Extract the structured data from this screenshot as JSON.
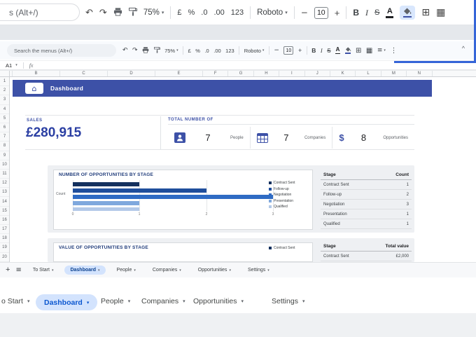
{
  "toolbar": {
    "search_full": "Search the menus (Alt+/)",
    "search_cropped": "s (Alt+/)",
    "zoom": "75%",
    "currency": "£",
    "percent": "%",
    "decimal_decrease": ".0",
    "decimal_increase": ".00",
    "format_number": "123",
    "font_name": "Roboto",
    "minus": "−",
    "font_size": "10",
    "plus": "+",
    "bold": "B",
    "italic": "I",
    "strikethrough": "S",
    "text_color": "A"
  },
  "icons": {
    "undo": "↶",
    "redo": "↷",
    "caret_down": "▾",
    "borders": "⊞",
    "merge": "▦",
    "align": "≡",
    "more_vertical": "⋮",
    "collapse": "^",
    "plus": "+",
    "hamburger": "≡",
    "home": "⌂",
    "dollar": "$"
  },
  "formula_bar": {
    "cell_reference": "A1",
    "fx_label": "fx"
  },
  "grid": {
    "column_letters": [
      "B",
      "C",
      "D",
      "E",
      "F",
      "G",
      "H",
      "I",
      "J",
      "K",
      "L",
      "M",
      "N"
    ],
    "row_numbers": [
      "1",
      "2",
      "3",
      "4",
      "5",
      "6",
      "7",
      "8",
      "9",
      "10",
      "11",
      "12",
      "13",
      "14",
      "15",
      "16",
      "17",
      "18",
      "19",
      "20"
    ]
  },
  "dashboard": {
    "header_title": "Dashboard",
    "sales_label": "SALES",
    "sales_value": "£280,915",
    "totals_label": "TOTAL NUMBER OF",
    "metrics": [
      {
        "value": "7",
        "label": "People"
      },
      {
        "value": "7",
        "label": "Companies"
      },
      {
        "value": "8",
        "label": "Opportunities"
      }
    ],
    "opportunities_chart": {
      "type": "bar",
      "title": "NUMBER OF OPPORTUNITIES BY STAGE",
      "ylabel": "Count",
      "categories": [
        "Contract Sent",
        "Follow-up",
        "Negotiation",
        "Presentation",
        "Qualified"
      ],
      "values": [
        1,
        2,
        3,
        1,
        1
      ],
      "colors": [
        "#14305e",
        "#1f4e9c",
        "#2f6bc4",
        "#7fa8dd",
        "#b3c9e8"
      ],
      "x_ticks": [
        "0",
        "1",
        "2",
        "3"
      ],
      "xlim": [
        0,
        3
      ],
      "legend_position": "right"
    },
    "stage_count_table": {
      "headers": [
        "Stage",
        "Count"
      ],
      "rows": [
        [
          "Contract Sent",
          "1"
        ],
        [
          "Follow-up",
          "2"
        ],
        [
          "Negotiation",
          "3"
        ],
        [
          "Presentation",
          "1"
        ],
        [
          "Qualified",
          "1"
        ]
      ]
    },
    "value_chart_title": "VALUE OF OPPORTUNITIES BY STAGE",
    "value_chart_legend": [
      "Contract Sent"
    ],
    "value_table": {
      "headers": [
        "Stage",
        "Total value"
      ],
      "rows": [
        [
          "Contract Sent",
          "£2,000"
        ]
      ]
    }
  },
  "sheet_tabs": {
    "items": [
      "To Start",
      "Dashboard",
      "People",
      "Companies",
      "Opportunities",
      "Settings"
    ],
    "active": "Dashboard"
  },
  "zoomed_tabs": {
    "items": [
      "o Start",
      "Dashboard",
      "People",
      "Companies",
      "Opportunities",
      "Settings"
    ],
    "active": "Dashboard"
  },
  "colors": {
    "dashboard_header_blue": "#3d51a7",
    "sales_value_blue": "#2b3fa3",
    "active_tab_bg": "#d3e3fd",
    "active_tab_text": "#0b57d0",
    "fill_color_indicator": "#3d51a7",
    "selection_line_blue": "#3565d8"
  }
}
